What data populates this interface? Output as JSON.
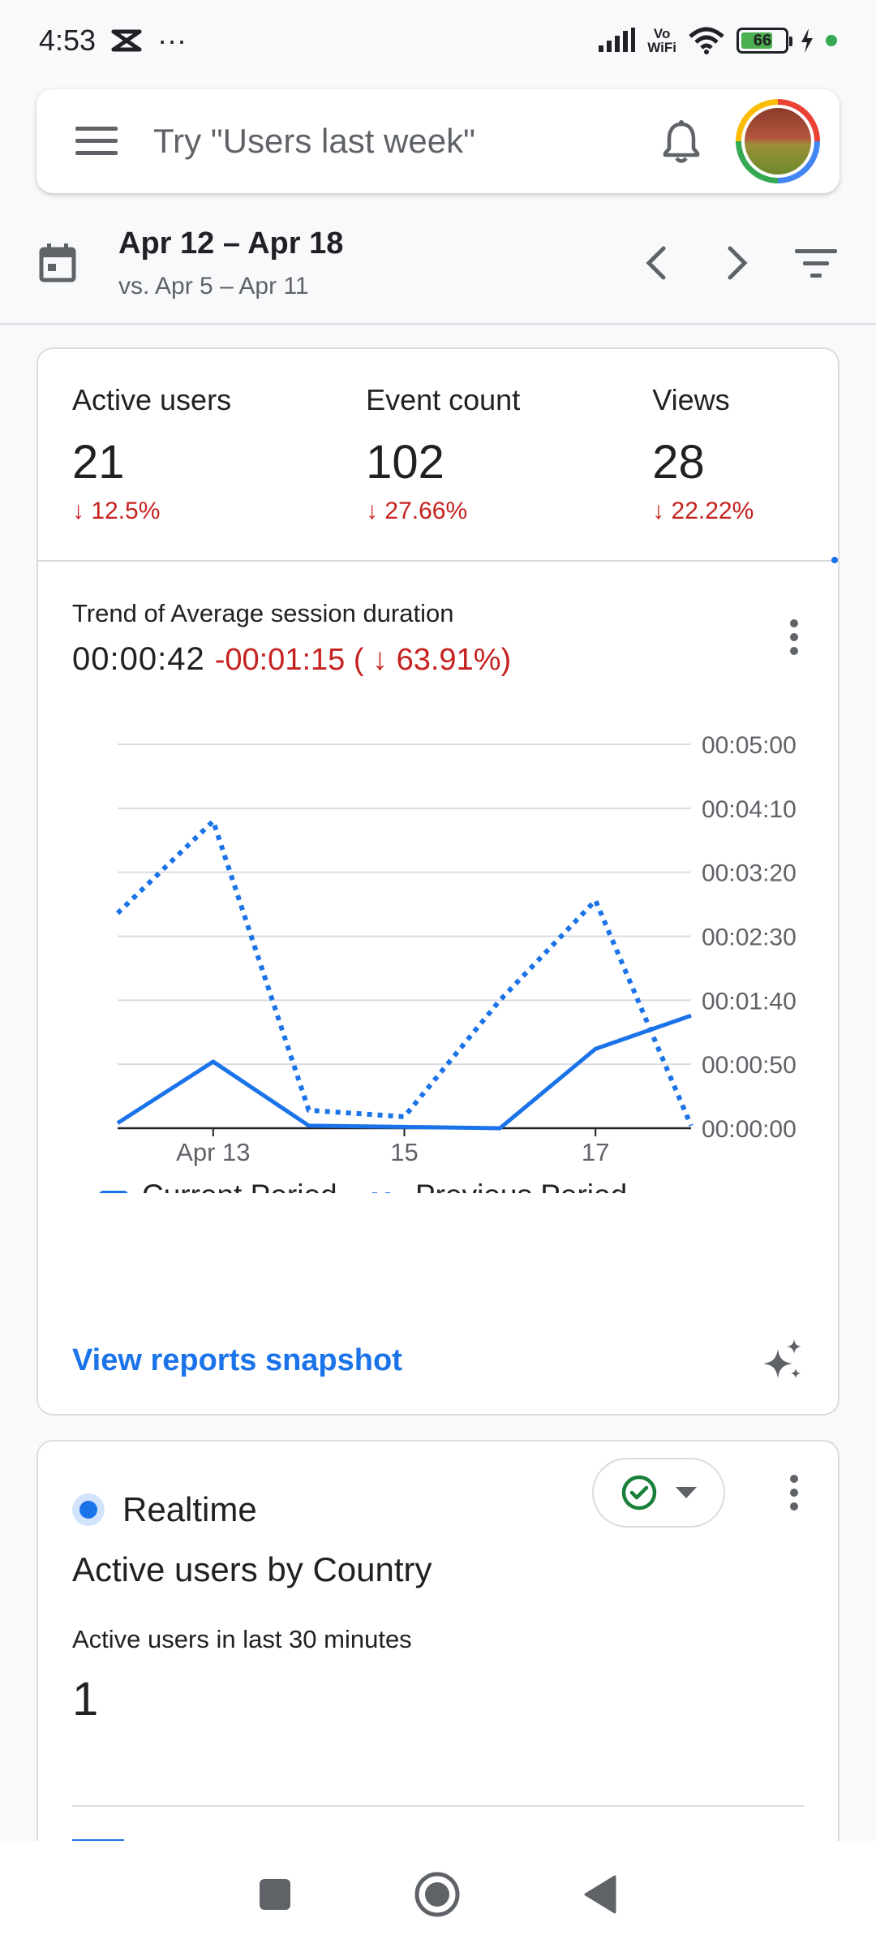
{
  "status_bar": {
    "time": "4:53",
    "more": "···",
    "vowifi_top": "Vo",
    "vowifi_bottom": "WiFi",
    "battery": "66"
  },
  "search": {
    "placeholder": "Try \"Users last week\""
  },
  "date_range": {
    "main": "Apr 12 – Apr 18",
    "comparison": "vs. Apr 5 – Apr 11"
  },
  "metrics": [
    {
      "label": "Active users",
      "value": "21",
      "delta": "↓ 12.5%"
    },
    {
      "label": "Event count",
      "value": "102",
      "delta": "↓ 27.66%"
    },
    {
      "label": "Views",
      "value": "28",
      "delta": "↓ 22.22%"
    }
  ],
  "trend": {
    "title": "Trend of Average session duration",
    "value": "00:00:42",
    "delta": "-00:01:15 ( ↓ 63.91%)"
  },
  "chart_data": {
    "type": "line",
    "y_tick_labels": [
      "00:00:00",
      "00:00:50",
      "00:01:40",
      "00:02:30",
      "00:03:20",
      "00:04:10",
      "00:05:00"
    ],
    "y_tick_seconds": [
      0,
      50,
      100,
      150,
      200,
      250,
      300
    ],
    "ylim": [
      0,
      300
    ],
    "x": [
      "Apr 12",
      "Apr 13",
      "Apr 14",
      "Apr 15",
      "Apr 16",
      "Apr 17",
      "Apr 18"
    ],
    "x_tick_labels": [
      {
        "index": 1,
        "label": "Apr 13"
      },
      {
        "index": 3,
        "label": "15"
      },
      {
        "index": 5,
        "label": "17"
      }
    ],
    "series": [
      {
        "name": "Current Period",
        "style": "solid",
        "color": "#1a73e8",
        "values": [
          4,
          52,
          2,
          1,
          0,
          62,
          88
        ]
      },
      {
        "name": "Previous Period",
        "style": "dotted",
        "color": "#1a73e8",
        "values": [
          168,
          240,
          14,
          9,
          100,
          178,
          2
        ]
      }
    ],
    "grid": true,
    "legend_position": "bottom-left"
  },
  "snapshot_link": "View reports snapshot",
  "realtime": {
    "label": "Realtime",
    "title": "Active users by Country",
    "subtitle": "Active users in last 30 minutes",
    "value": "1"
  },
  "icons": {
    "menu": "menu-icon",
    "bell": "bell-icon",
    "calendar": "calendar-icon",
    "prev": "chevron-left-icon",
    "next": "chevron-right-icon",
    "filter": "filter-icon",
    "more": "more-vert-icon",
    "sparkle": "sparkle-icon",
    "check": "check-circle-icon"
  }
}
